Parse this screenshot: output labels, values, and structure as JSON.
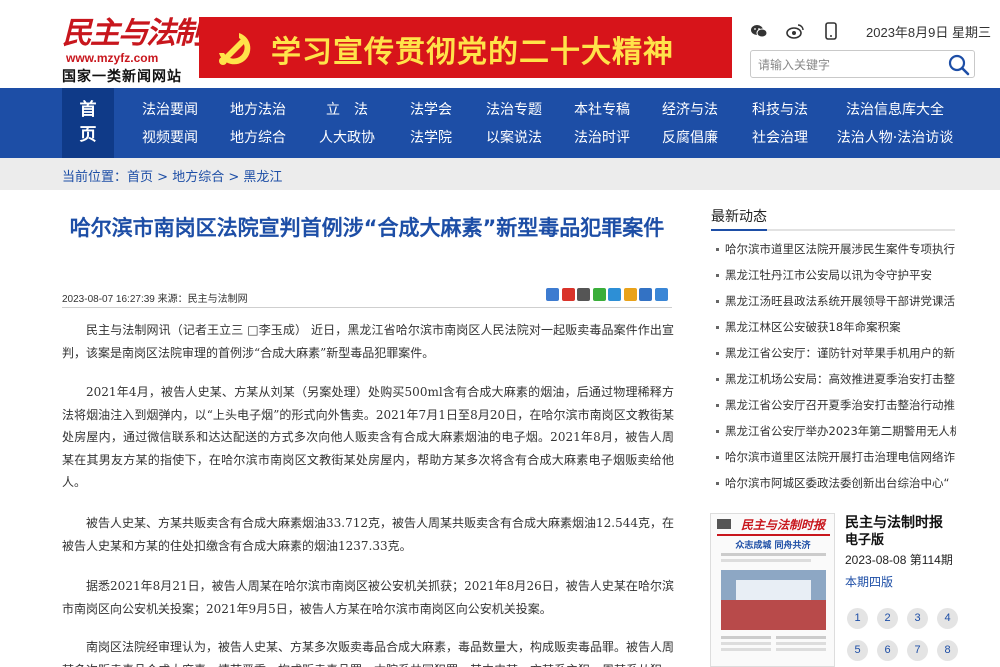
{
  "header": {
    "logo_text": "民主与法制网",
    "logo_url": "www.mzyfz.com",
    "logo_slogan": "国家一类新闻网站",
    "banner_text": "学习宣传贯彻党的二十大精神",
    "date": "2023年8月9日  星期三",
    "search_placeholder": "请输入关键字",
    "social_icons": [
      "wechat-icon",
      "weibo-icon",
      "mobile-icon"
    ]
  },
  "nav": {
    "home_label": "首页",
    "row1": [
      "法治要闻",
      "地方法治",
      "立　法",
      "法学会",
      "法治专题",
      "本社专稿",
      "经济与法",
      "科技与法",
      "法治信息库大全"
    ],
    "row2": [
      "视频要闻",
      "地方综合",
      "人大政协",
      "法学院",
      "以案说法",
      "法治时评",
      "反腐倡廉",
      "社会治理",
      "法治人物·法治访谈"
    ]
  },
  "breadcrumb": {
    "prefix": "当前位置：",
    "items": [
      "首页",
      "地方综合",
      "黑龙江"
    ],
    "separator": " > "
  },
  "article": {
    "title": "哈尔滨市南岗区法院宣判首例涉“合成大麻素”新型毒品犯罪案件",
    "meta": "2023-08-07 16:27:39  来源：民主与法制网",
    "paragraphs": [
      "民主与法制网讯（记者王立三 □李玉成） 近日，黑龙江省哈尔滨市南岗区人民法院对一起贩卖毒品案件作出宣判，该案是南岗区法院审理的首例涉“合成大麻素”新型毒品犯罪案件。",
      "2021年4月，被告人史某、方某从刘某（另案处理）处购买500ml含有合成大麻素的烟油，后通过物理稀释方法将烟油注入到烟弹内，以“上头电子烟”的形式向外售卖。2021年7月1日至8月20日，在哈尔滨市南岗区文教街某处房屋内，通过微信联系和达达配送的方式多次向他人贩卖含有合成大麻素烟油的电子烟。2021年8月，被告人周某在其男友方某的指使下，在哈尔滨市南岗区文教街某处房屋内，帮助方某多次将含有合成大麻素电子烟贩卖给他人。",
      "被告人史某、方某共贩卖含有合成大麻素烟油33.712克，被告人周某共贩卖含有合成大麻素烟油12.544克，在被告人史某和方某的住处扣缴含有合成大麻素的烟油1237.33克。",
      "据悉2021年8月21日，被告人周某在哈尔滨市南岗区被公安机关抓获；2021年8月26日，被告人史某在哈尔滨市南岗区向公安机关投案；2021年9月5日，被告人方某在哈尔滨市南岗区向公安机关投案。",
      "南岗区法院经审理认为，被告人史某、方某多次贩卖毒品合成大麻素，毒品数量大，构成贩卖毒品罪。被告人周某多次贩卖毒品合成大麻素，情节严重，构成贩卖毒品罪。本院系共同犯罪，其中史某、方某系主犯，周某系从犯。"
    ]
  },
  "share_icons": [
    {
      "name": "share-qzone-icon",
      "color": "#3d7bd0"
    },
    {
      "name": "share-weibo-icon",
      "color": "#d9332a"
    },
    {
      "name": "share-tencent-icon",
      "color": "#555555"
    },
    {
      "name": "share-wechat-icon",
      "color": "#3aae3a"
    },
    {
      "name": "share-qq-icon",
      "color": "#2d8fd6"
    },
    {
      "name": "share-star-icon",
      "color": "#e9a21a"
    },
    {
      "name": "share-renren-icon",
      "color": "#3372c4"
    },
    {
      "name": "share-more-icon",
      "color": "#3a86d6"
    }
  ],
  "sidebar": {
    "title": "最新动态",
    "news": [
      "哈尔滨市道里区法院开展涉民生案件专项执行",
      "黑龙江牡丹江市公安局以讯为令守护平安",
      "黑龙江汤旺县政法系统开展领导干部讲党课活",
      "黑龙江林区公安破获18年命案积案",
      "黑龙江省公安厅：谨防针对苹果手机用户的新",
      "黑龙江机场公安局：高效推进夏季治安打击整",
      "黑龙江省公安厅召开夏季治安打击整治行动推",
      "黑龙江省公安厅举办2023年第二期警用无人机",
      "哈尔滨市道里区法院开展打击治理电信网络诈",
      "哈尔滨市阿城区委政法委创新出台综治中心“"
    ],
    "newspaper": {
      "thumb_title": "民主与法制时报",
      "thumb_headline": "众志成城 同舟共济",
      "name": "民主与法制时报",
      "sub": "电子版",
      "date": "2023-08-08 第114期",
      "edition": "本期四版",
      "pages": [
        "1",
        "2",
        "3",
        "4",
        "5",
        "6",
        "7",
        "8"
      ]
    }
  },
  "colors": {
    "brand_red": "#c8161d",
    "nav_blue": "#1d4ea6",
    "nav_home_blue": "#0f3a88",
    "banner_red": "#d7141a",
    "banner_yellow": "#ffe34a"
  }
}
